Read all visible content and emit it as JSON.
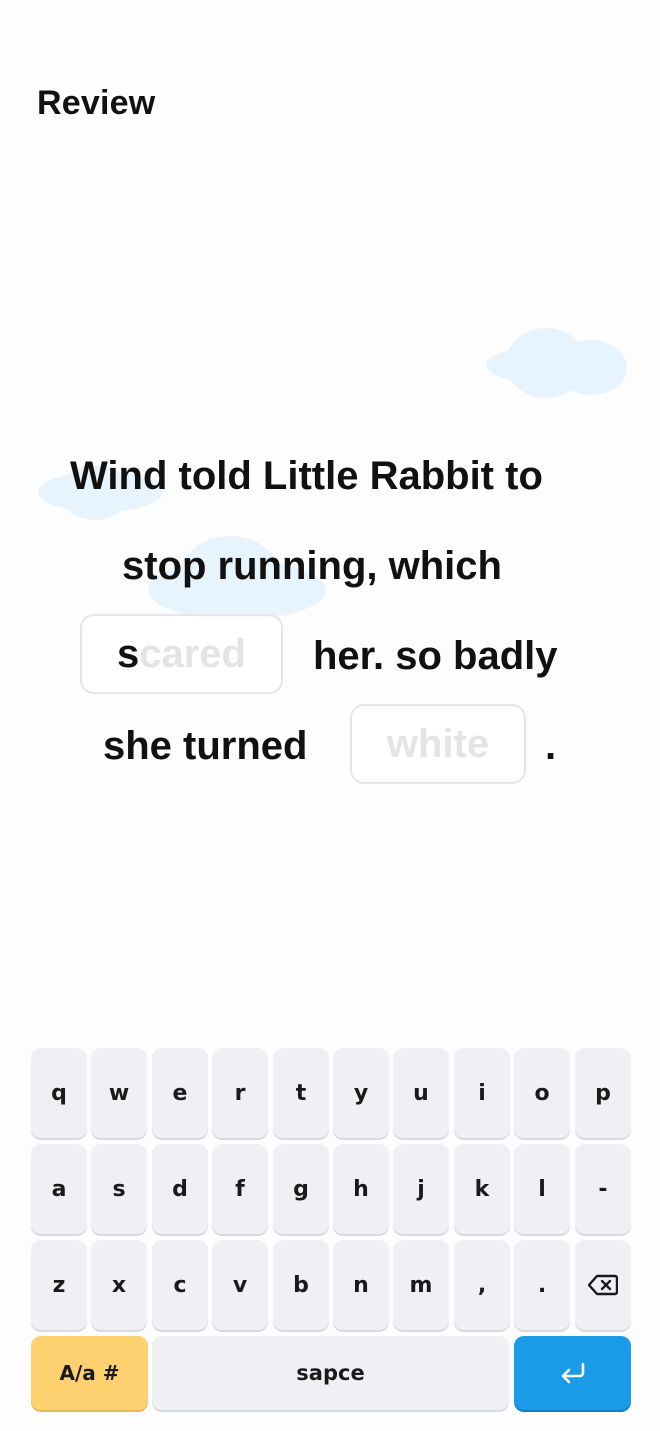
{
  "header": {
    "title": "Review"
  },
  "sentence": {
    "line1": "Wind told Little Rabbit to",
    "line2": "stop running, which",
    "blank1": {
      "typed": "s",
      "hint": "cared"
    },
    "after_blank1": "her. so badly",
    "before_blank2": "she turned",
    "blank2": {
      "typed": "",
      "hint": "white"
    },
    "end": "."
  },
  "keyboard": {
    "row1": [
      "q",
      "w",
      "e",
      "r",
      "t",
      "y",
      "u",
      "i",
      "o",
      "p"
    ],
    "row2": [
      "a",
      "s",
      "d",
      "f",
      "g",
      "h",
      "j",
      "k",
      "l",
      "-"
    ],
    "row3": [
      "z",
      "x",
      "c",
      "v",
      "b",
      "n",
      "m",
      ",",
      "."
    ],
    "shift_label": "A/a #",
    "space_label": "sapce",
    "backspace_icon": "backspace-icon",
    "enter_icon": "enter-icon",
    "colors": {
      "key": "#eff0f3",
      "shift": "#fdd070",
      "enter": "#1a9be8"
    }
  }
}
